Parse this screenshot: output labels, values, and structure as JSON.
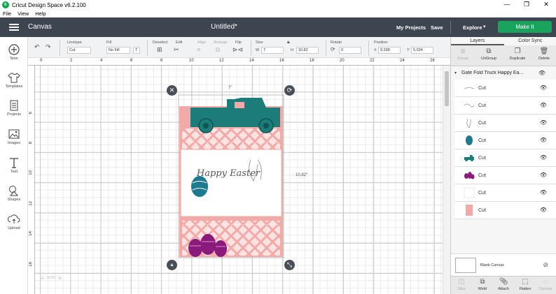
{
  "window": {
    "title": "Cricut Design Space  v6.2.100",
    "minimize": "—",
    "maximize": "❐",
    "close": "✕"
  },
  "menu": [
    "File",
    "View",
    "Help"
  ],
  "header": {
    "canvas_label": "Canvas",
    "document_title": "Untitled*",
    "my_projects": "My Projects",
    "save": "Save",
    "explore": "Explore",
    "make_it": "Make It",
    "make_it_color": "#1aa35c",
    "bar_color": "#3d4551"
  },
  "sidebar": [
    {
      "label": "New",
      "icon": "plus-icon"
    },
    {
      "label": "Templates",
      "icon": "shirt-icon"
    },
    {
      "label": "Projects",
      "icon": "projects-icon"
    },
    {
      "label": "Images",
      "icon": "image-icon"
    },
    {
      "label": "Text",
      "icon": "text-icon"
    },
    {
      "label": "Shapes",
      "icon": "shapes-icon"
    },
    {
      "label": "Upload",
      "icon": "upload-icon"
    }
  ],
  "toolbar": {
    "linetype_label": "Linetype",
    "linetype_value": "Cut",
    "fill_label": "Fill",
    "fill_value": "No Fill",
    "deselect": "Deselect",
    "edit": "Edit",
    "align": "Align",
    "arrange": "Arrange",
    "flip": "Flip",
    "size": "Size",
    "w_label": "W",
    "w_value": "7",
    "h_label": "H",
    "h_value": "10.82",
    "rotate": "Rotate",
    "rotate_value": "0",
    "position": "Position",
    "x_label": "X",
    "x_value": "9.298",
    "y_label": "Y",
    "y_value": "5.034"
  },
  "ruler": {
    "top": [
      "0",
      "2",
      "4",
      "6",
      "8",
      "10",
      "12",
      "14",
      "16",
      "18",
      "20",
      "22",
      "24",
      "26"
    ],
    "left": [
      "6",
      "8",
      "10",
      "12",
      "14",
      "16"
    ]
  },
  "canvas": {
    "width_label": "7\"",
    "height_label": "10.82\"",
    "card_text": "Happy Easter",
    "zoom_value": "50%",
    "colors": {
      "teal": "#1c7c79",
      "pink": "#f2aaa8",
      "purple": "#8a1a7c",
      "egg_blue": "#1e7a8e"
    }
  },
  "panel": {
    "tabs": [
      "Layers",
      "Color Sync"
    ],
    "actions": [
      "Group",
      "UnGroup",
      "Duplicate",
      "Delete"
    ],
    "group_name": "Gate Fold Truck Happy Ea...",
    "layers": [
      {
        "name": "Cut",
        "thumb": "line-art-thumb-1"
      },
      {
        "name": "Cut",
        "thumb": "line-art-thumb-2"
      },
      {
        "name": "Cut",
        "thumb": "bunny-ear-thumb"
      },
      {
        "name": "Cut",
        "thumb": "blue-egg-thumb"
      },
      {
        "name": "Cut",
        "thumb": "teal-truck-thumb"
      },
      {
        "name": "Cut",
        "thumb": "purple-eggs-thumb"
      },
      {
        "name": "Cut",
        "thumb": "white-card-thumb"
      },
      {
        "name": "Cut",
        "thumb": "pink-card-thumb"
      }
    ],
    "blank_canvas": "Blank Canvas",
    "bottom_actions": [
      "Slice",
      "Weld",
      "Attach",
      "Flatten",
      "Contour"
    ]
  }
}
